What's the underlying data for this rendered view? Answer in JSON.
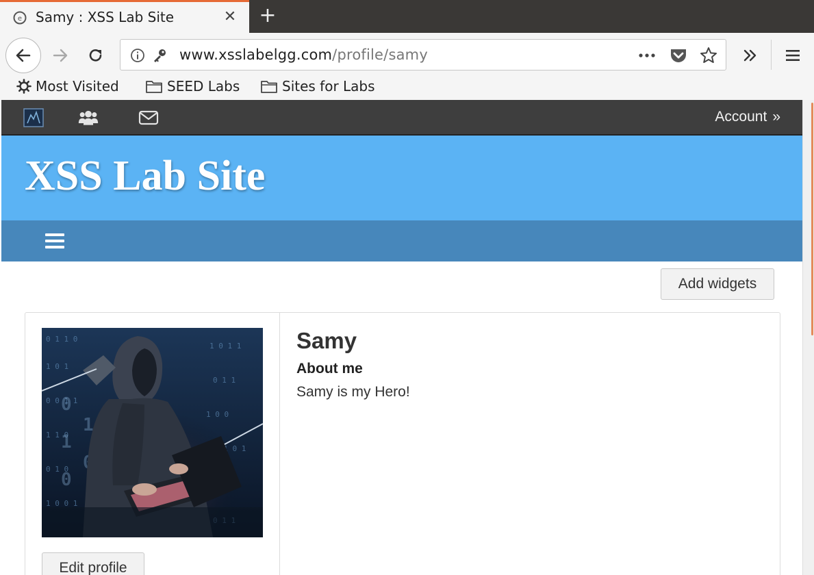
{
  "browser": {
    "tab_title": "Samy : XSS Lab Site",
    "tab_close": "✕",
    "new_tab": "+",
    "url_domain": "www.xsslabelgg.com",
    "url_path": "/profile/samy",
    "accent_color": "#e66a36",
    "icons": [
      "back-arrow-icon",
      "forward-arrow-icon",
      "reload-icon",
      "info-icon",
      "key-icon",
      "more-icon",
      "pocket-icon",
      "star-icon",
      "overflow-icon",
      "menu-icon"
    ]
  },
  "bookmarks": {
    "most_visited": "Most Visited",
    "seed_labs": "SEED Labs",
    "sites_for_labs": "Sites for Labs"
  },
  "site": {
    "account": "Account",
    "account_arrow": "»",
    "title": "XSS Lab Site",
    "banner_color": "#5bb3f4",
    "menubar_color": "#4787bb",
    "topbar_color": "#3e3e3e"
  },
  "profile": {
    "add_widgets": "Add widgets",
    "name": "Samy",
    "about_label": "About me",
    "about_text": "Samy is my Hero!",
    "edit_profile": "Edit profile"
  }
}
